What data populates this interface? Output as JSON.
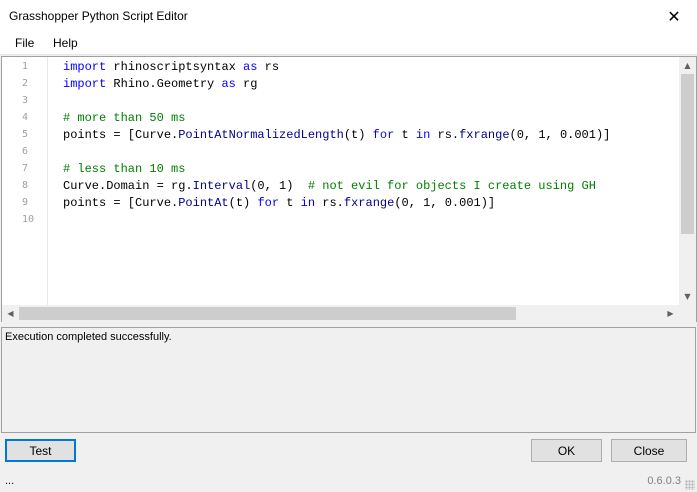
{
  "window": {
    "title": "Grasshopper Python Script Editor",
    "close_glyph": "✕"
  },
  "menu": {
    "items": [
      "File",
      "Help"
    ]
  },
  "editor": {
    "line_numbers": [
      "1",
      "2",
      "3",
      "4",
      "5",
      "6",
      "7",
      "8",
      "9",
      "10"
    ],
    "lines": [
      [
        {
          "t": "import",
          "c": "kw"
        },
        {
          "t": " rhinoscriptsyntax ",
          "c": ""
        },
        {
          "t": "as",
          "c": "kw"
        },
        {
          "t": " rs",
          "c": ""
        }
      ],
      [
        {
          "t": "import",
          "c": "kw"
        },
        {
          "t": " Rhino.Geometry ",
          "c": ""
        },
        {
          "t": "as",
          "c": "kw"
        },
        {
          "t": " rg",
          "c": ""
        }
      ],
      [],
      [
        {
          "t": "# more than 50 ms",
          "c": "cm"
        }
      ],
      [
        {
          "t": "points = [Curve.",
          "c": ""
        },
        {
          "t": "PointAtNormalizedLength",
          "c": "fn"
        },
        {
          "t": "(t) ",
          "c": ""
        },
        {
          "t": "for",
          "c": "kw"
        },
        {
          "t": " t ",
          "c": ""
        },
        {
          "t": "in",
          "c": "kw"
        },
        {
          "t": " rs.",
          "c": ""
        },
        {
          "t": "fxrange",
          "c": "fn"
        },
        {
          "t": "(0, 1, 0.001)]",
          "c": ""
        }
      ],
      [],
      [
        {
          "t": "# less than 10 ms",
          "c": "cm"
        }
      ],
      [
        {
          "t": "Curve.Domain = rg.",
          "c": ""
        },
        {
          "t": "Interval",
          "c": "fn"
        },
        {
          "t": "(0, 1)  ",
          "c": ""
        },
        {
          "t": "# not evil for objects I create using GH",
          "c": "cm"
        }
      ],
      [
        {
          "t": "points = [Curve.",
          "c": ""
        },
        {
          "t": "PointAt",
          "c": "fn"
        },
        {
          "t": "(t) ",
          "c": ""
        },
        {
          "t": "for",
          "c": "kw"
        },
        {
          "t": " t ",
          "c": ""
        },
        {
          "t": "in",
          "c": "kw"
        },
        {
          "t": " rs.",
          "c": ""
        },
        {
          "t": "fxrange",
          "c": "fn"
        },
        {
          "t": "(0, 1, 0.001)]",
          "c": ""
        }
      ],
      []
    ],
    "scroll_icons": {
      "up": "▲",
      "down": "▼",
      "left": "◀",
      "right": "▶"
    }
  },
  "output": {
    "message": "Execution completed successfully."
  },
  "buttons": {
    "test": "Test",
    "ok": "OK",
    "close": "Close"
  },
  "status": {
    "left": "...",
    "version": "0.6.0.3"
  },
  "colors": {
    "keyword": "#0000ff",
    "function": "#00008b",
    "comment": "#008000",
    "focus_border": "#0078d7"
  }
}
